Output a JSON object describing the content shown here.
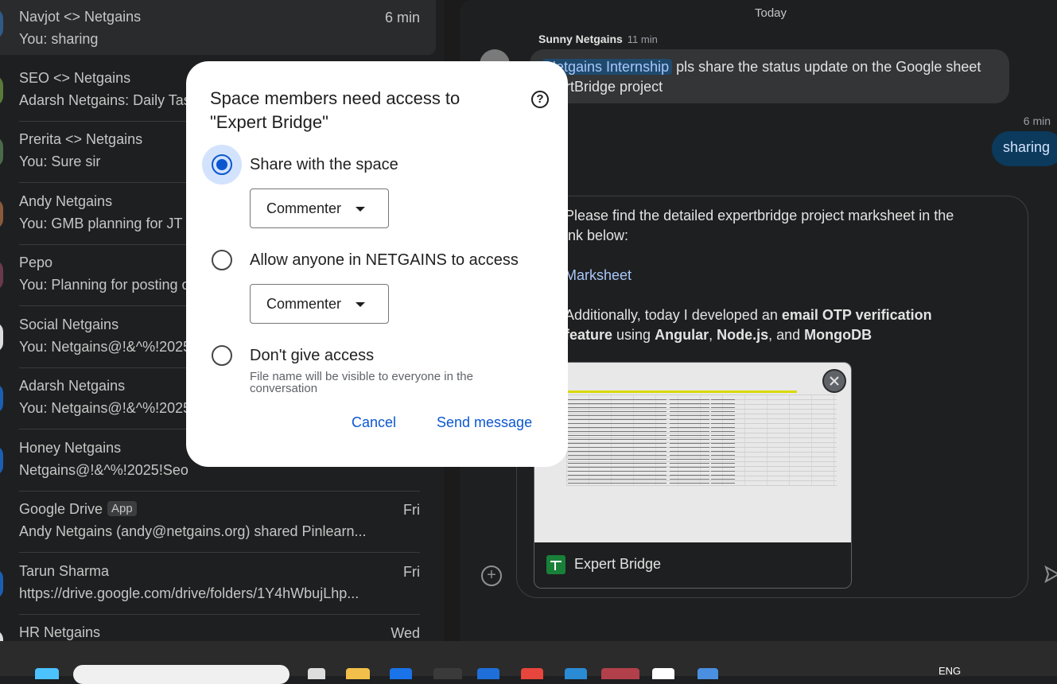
{
  "conversations": [
    {
      "name": "Navjot <> Netgains",
      "snippet": "You: sharing",
      "time": "6 min",
      "active": true
    },
    {
      "name": "SEO <> Netgains",
      "snippet": "Adarsh Netgains: Daily Tas",
      "time": ""
    },
    {
      "name": "Prerita <> Netgains",
      "snippet": "You: Sure sir",
      "time": ""
    },
    {
      "name": "Andy Netgains",
      "snippet": "You: GMB planning for JT W",
      "time": ""
    },
    {
      "name": "Pepo",
      "snippet": "You: Planning for posting o",
      "time": ""
    },
    {
      "name": "Social Netgains",
      "snippet": "You: Netgains@!&^%!2025",
      "time": ""
    },
    {
      "name": "Adarsh Netgains",
      "snippet": "You: Netgains@!&^%!2025",
      "time": ""
    },
    {
      "name": "Honey Netgains",
      "snippet": "Netgains@!&^%!2025!Seo",
      "time": ""
    },
    {
      "name": "Google Drive",
      "badge": "App",
      "snippet": "Andy Netgains (andy@netgains.org) shared Pinlearn...",
      "time": "Fri"
    },
    {
      "name": "Tarun Sharma",
      "snippet": "https://drive.google.com/drive/folders/1Y4hWbujLhp...",
      "time": "Fri"
    },
    {
      "name": "HR Netgains",
      "snippet": "",
      "time": "Wed"
    }
  ],
  "chat": {
    "date_divider": "Today",
    "message1": {
      "sender": "Sunny Netgains",
      "time": "11 min",
      "mention": "Netgains Internship",
      "text": "pls share the status update on the Google sheet",
      "text_line2": "xpertBridge project"
    },
    "my_message": {
      "time": "6 min",
      "text": "sharing"
    },
    "composer": {
      "line1": "Please find the detailed expertbridge project marksheet in the",
      "line2": "ink below:",
      "link": "Marksheet",
      "line3_pre": "Additionally, today I  developed an ",
      "line3_bold": "email OTP verification",
      "line4_bold1": "feature",
      "line4_mid1": " using ",
      "line4_bold2": "Angular",
      "line4_mid2": ", ",
      "line4_bold3": "Node.js",
      "line4_mid3": ", and ",
      "line4_bold4": "MongoDB",
      "attachment_title": "Expert Bridge"
    }
  },
  "dialog": {
    "title": "Space members need access to \"Expert Bridge\"",
    "options": [
      {
        "label": "Share with the space",
        "selected": true,
        "role": "Commenter"
      },
      {
        "label": "Allow anyone in NETGAINS to access",
        "selected": false,
        "role": "Commenter"
      },
      {
        "label": "Don't give access",
        "selected": false,
        "hint": "File name will be visible to everyone in the conversation"
      }
    ],
    "cancel_label": "Cancel",
    "send_label": "Send message"
  },
  "taskbar": {
    "lang": "ENG"
  },
  "colors": {
    "accent": "#0b57d0",
    "mention_bg": "#1f4a6e",
    "link": "#a8c7fa",
    "sheets_green": "#188038"
  }
}
